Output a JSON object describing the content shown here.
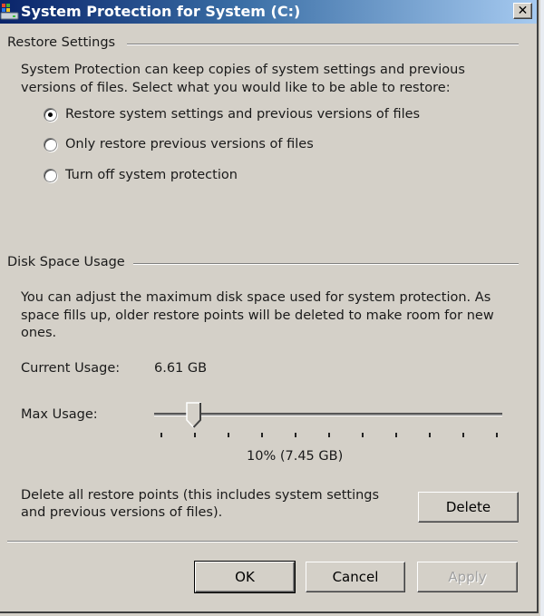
{
  "window": {
    "title": "System Protection for System (C:)",
    "close_label": "✕"
  },
  "restore_settings": {
    "group_label": "Restore Settings",
    "description_line1": "System Protection can keep copies of system settings and previous",
    "description_line2": "versions of files. Select what you would like to be able to restore:",
    "options": [
      {
        "label": "Restore system settings and previous versions of files",
        "checked": true
      },
      {
        "label": "Only restore previous versions of files",
        "checked": false
      },
      {
        "label": "Turn off system protection",
        "checked": false
      }
    ]
  },
  "disk_space": {
    "group_label": "Disk Space Usage",
    "description_line1": "You can adjust the maximum disk space used for system protection. As",
    "description_line2": "space fills up, older restore points will be deleted to make room for new",
    "description_line3": "ones.",
    "current_usage_label": "Current Usage:",
    "current_usage_value": "6.61 GB",
    "max_usage_label": "Max Usage:",
    "max_usage_percent": 10,
    "max_usage_readout": "10% (7.45 GB)",
    "tick_count": 11,
    "delete_text_line1": "Delete all restore points (this includes system settings",
    "delete_text_line2": "and previous versions of files).",
    "delete_button": "Delete"
  },
  "footer": {
    "ok": "OK",
    "cancel": "Cancel",
    "apply": "Apply"
  },
  "colors": {
    "title_start": "#0a246a",
    "title_end": "#a6caf0",
    "face": "#d4d0c8"
  }
}
